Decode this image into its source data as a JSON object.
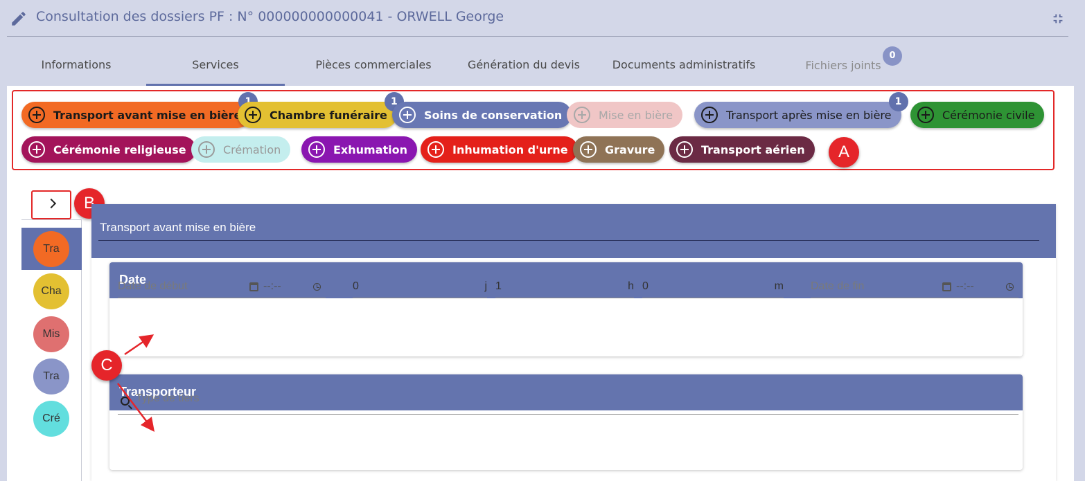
{
  "header": {
    "title": "Consultation des dossiers PF : N° 000000000000041 - ORWELL George"
  },
  "tabs": [
    {
      "label": "Informations"
    },
    {
      "label": "Services"
    },
    {
      "label": "Pièces commerciales"
    },
    {
      "label": "Génération du devis"
    },
    {
      "label": "Documents administratifs"
    },
    {
      "label": "Fichiers joints",
      "badge": "0"
    }
  ],
  "services": [
    {
      "label": "Transport avant mise en bière",
      "color": "#f26a24",
      "badge": "1"
    },
    {
      "label": "Chambre funéraire",
      "color": "#e3c032",
      "badge": "1"
    },
    {
      "label": "Soins de conservation",
      "color": "#6877b3"
    },
    {
      "label": "Mise en bière",
      "color": "#f0c6c6"
    },
    {
      "label": "Transport après mise en bière",
      "color": "#8a95c8",
      "badge": "1"
    },
    {
      "label": "Cérémonie civile",
      "color": "#2e9334"
    },
    {
      "label": "Cérémonie religieuse",
      "color": "#a3145a"
    },
    {
      "label": "Crémation",
      "color": "#c4eeee"
    },
    {
      "label": "Exhumation",
      "color": "#8a16b0"
    },
    {
      "label": "Inhumation d'urne",
      "color": "#e4201a"
    },
    {
      "label": "Gravure",
      "color": "#8f7356"
    },
    {
      "label": "Transport aérien",
      "color": "#6b2a44"
    }
  ],
  "markers": {
    "a": "A",
    "b": "B",
    "c": "C"
  },
  "rail": [
    {
      "label": "Tra",
      "color": "#f26a24"
    },
    {
      "label": "Cha",
      "color": "#e3c032"
    },
    {
      "label": "Mis",
      "color": "#df7070"
    },
    {
      "label": "Tra",
      "color": "#8a95c8"
    },
    {
      "label": "Cré",
      "color": "#62dede"
    }
  ],
  "content": {
    "title": "Transport avant mise en bière",
    "date_section": {
      "title": "Date",
      "start_placeholder": "Date de début",
      "start_time": "--:--",
      "days_value": "0",
      "days_unit": "j",
      "hours_value": "1",
      "hours_unit": "h",
      "minutes_value": "0",
      "minutes_unit": "m",
      "end_placeholder": "Date de fin",
      "end_time": "--:--"
    },
    "carrier_section": {
      "title": "Transporteur",
      "search_placeholder": "Type de tiers"
    }
  }
}
